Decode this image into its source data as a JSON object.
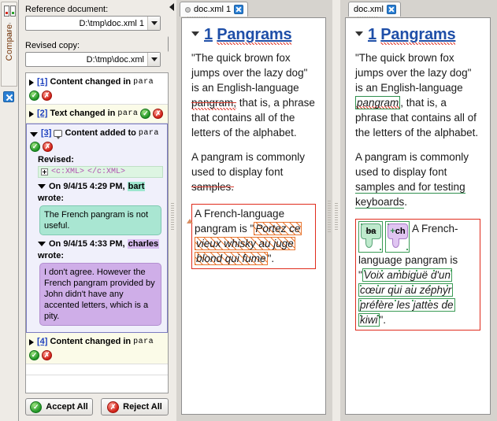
{
  "vertical_tab": {
    "label": "Compare",
    "docs_icon": "two-documents-icon",
    "close_icon": "close-icon"
  },
  "compare_panel": {
    "reference_label": "Reference document:",
    "reference_value": "D:\\tmp\\doc.xml 1",
    "revised_label": "Revised copy:",
    "revised_value": "D:\\tmp\\doc.xml",
    "refresh_icon": "refresh-icon",
    "dropdown_icon": "chevron-down-icon"
  },
  "changes": [
    {
      "index": "[1]",
      "title": "Content changed in",
      "element": "para",
      "state": "collapsed",
      "accept": "accept-icon",
      "reject": "reject-icon"
    },
    {
      "index": "[2]",
      "title": "Text changed in",
      "element": "para",
      "state": "collapsed",
      "accept": "accept-icon",
      "reject": "reject-icon"
    },
    {
      "index": "[3]",
      "title": "Content added to",
      "element": "para",
      "state": "expanded",
      "has_comment": true,
      "accept": "accept-icon",
      "reject": "reject-icon",
      "revised_label": "Revised:",
      "revised_xml_open": "<c:XML>",
      "revised_xml_close": "</c:XML>",
      "comments": [
        {
          "header_prefix": "On 9/4/15 4:29 PM,",
          "author": "bart",
          "header_suffix": "wrote:",
          "body": "The French pangram is not useful."
        },
        {
          "header_prefix": "On 9/4/15 4:33 PM,",
          "author": "charles",
          "header_suffix": "wrote:",
          "body": "I don't agree. However the French pangram provided by John didn't have any accented letters, which is a pity."
        }
      ]
    },
    {
      "index": "[4]",
      "title": "Content changed in",
      "element": "para",
      "state": "collapsed",
      "accept": "accept-icon",
      "reject": "reject-icon"
    }
  ],
  "buttons": {
    "accept_all": "Accept All",
    "reject_all": "Reject All"
  },
  "left_editor": {
    "tab_label": "doc.xml 1",
    "tab_close_icon": "close-icon",
    "heading_number": "1",
    "heading_text": "Pangrams",
    "p1_a": "\"The quick brown fox jumps over the lazy dog\" is an English-language ",
    "p1_deleted": "pangram,",
    "p1_b": " that is, a phrase that contains all of the letters of the alphabet.",
    "p2_a": "A pangram is commonly used to display font",
    "p2_deleted": " samples",
    "p2_b": ".",
    "p3_a": "A French-language pangram is ",
    "p3_quote_open": "\"",
    "p3_highlighted": "Portez ce vieux whisky au juge blond qui fume",
    "p3_quote_close": "\"."
  },
  "right_editor": {
    "tab_label": "doc.xml",
    "tab_close_icon": "close-icon",
    "heading_number": "1",
    "heading_text": "Pangrams",
    "p1_a": "\"The quick brown fox jumps over the lazy dog\" is an English-language ",
    "p1_inserted": "pangram",
    "p1_b": ", that is, a phrase that contains all of the letters of the alphabet.",
    "p2_a": "A pangram is commonly used to display font",
    "p2_inserted": " samples and for testing keyboards",
    "p2_b": ".",
    "callouts": [
      {
        "initials": "ba",
        "color": "teal"
      },
      {
        "initials": "ch",
        "color": "purple"
      }
    ],
    "p3_a": "A French-language pangram is ",
    "p3_quote_open": "\"",
    "p3_inserted": "Voix ambiguë d'un cœur qui au zéphyr préfère les jattes de kiwi",
    "p3_quote_close": "\"."
  },
  "colors": {
    "link_blue": "#1b3fbe",
    "heading_blue": "#1f4fa8",
    "delete_red": "#d3372b",
    "insert_green": "#2f8f4e",
    "change_block_red": "#e02b1c",
    "hatch_orange": "#e8752f",
    "bart_highlight": "#9de6cf",
    "charles_highlight": "#d8bdf0"
  }
}
